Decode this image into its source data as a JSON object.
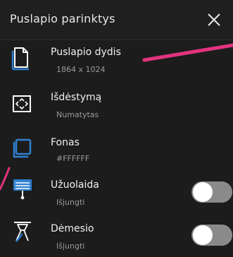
{
  "header": {
    "title": "Puslapio parinktys",
    "close_icon": "close-icon"
  },
  "options": [
    {
      "label": "Puslapio dydis",
      "value": "1864 x 1024",
      "icon": "page-icon",
      "toggle": null
    },
    {
      "label": "Išdėstymą",
      "value": "Numatytas",
      "icon": "layout-frame-icon",
      "toggle": null
    },
    {
      "label": "Fonas",
      "value": "#FFFFFF",
      "icon": "background-icon",
      "toggle": null
    },
    {
      "label": "Užuolaida",
      "value": "Išjungti",
      "icon": "curtain-icon",
      "toggle": false
    },
    {
      "label": "Dėmesio",
      "value": "Išjungti",
      "icon": "spotlight-icon",
      "toggle": false
    }
  ],
  "colors": {
    "background": "#1c1c1c",
    "accent_blue": "#2f80d0",
    "annotation_pink": "#e2337e",
    "toggle_off": "#8a8a8a"
  }
}
